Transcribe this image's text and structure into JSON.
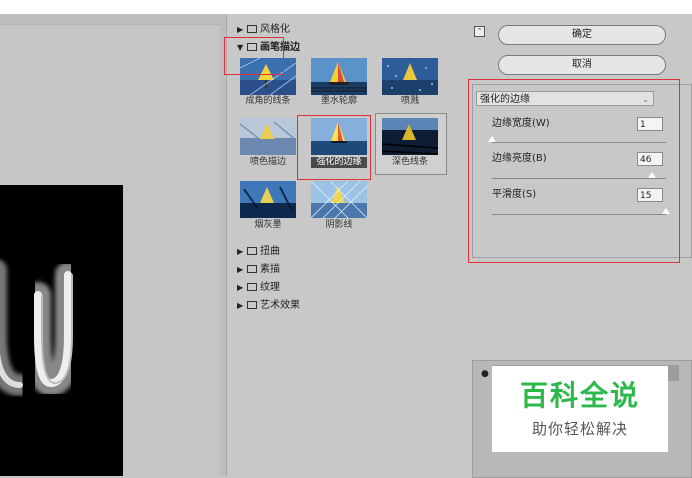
{
  "gallery": {
    "categories": {
      "stylize": "风格化",
      "brush_strokes": "画笔描边",
      "distort": "扭曲",
      "sketch": "素描",
      "texture": "纹理",
      "artistic": "艺术效果"
    },
    "filters": [
      {
        "label": "成角的线条"
      },
      {
        "label": "墨水轮廓"
      },
      {
        "label": "喷溅"
      },
      {
        "label": "喷色描边"
      },
      {
        "label": "强化的边缘"
      },
      {
        "label": "深色线条"
      },
      {
        "label": "烟灰墨"
      },
      {
        "label": "阴影线"
      }
    ],
    "selected_filter": "强化的边缘"
  },
  "buttons": {
    "ok": "确定",
    "cancel": "取消"
  },
  "settings": {
    "filter_select": "强化的边缘",
    "params": [
      {
        "label": "边缘宽度(W)",
        "value": "1",
        "level": 0.0
      },
      {
        "label": "边缘亮度(B)",
        "value": "46",
        "level": 0.92
      },
      {
        "label": "平滑度(S)",
        "value": "15",
        "level": 1.0
      }
    ]
  },
  "watermark": {
    "title": "百科全说",
    "subtitle": "助你轻松解决"
  },
  "colors": {
    "highlight": "#e0303a",
    "watermark_green": "#2db84b"
  }
}
